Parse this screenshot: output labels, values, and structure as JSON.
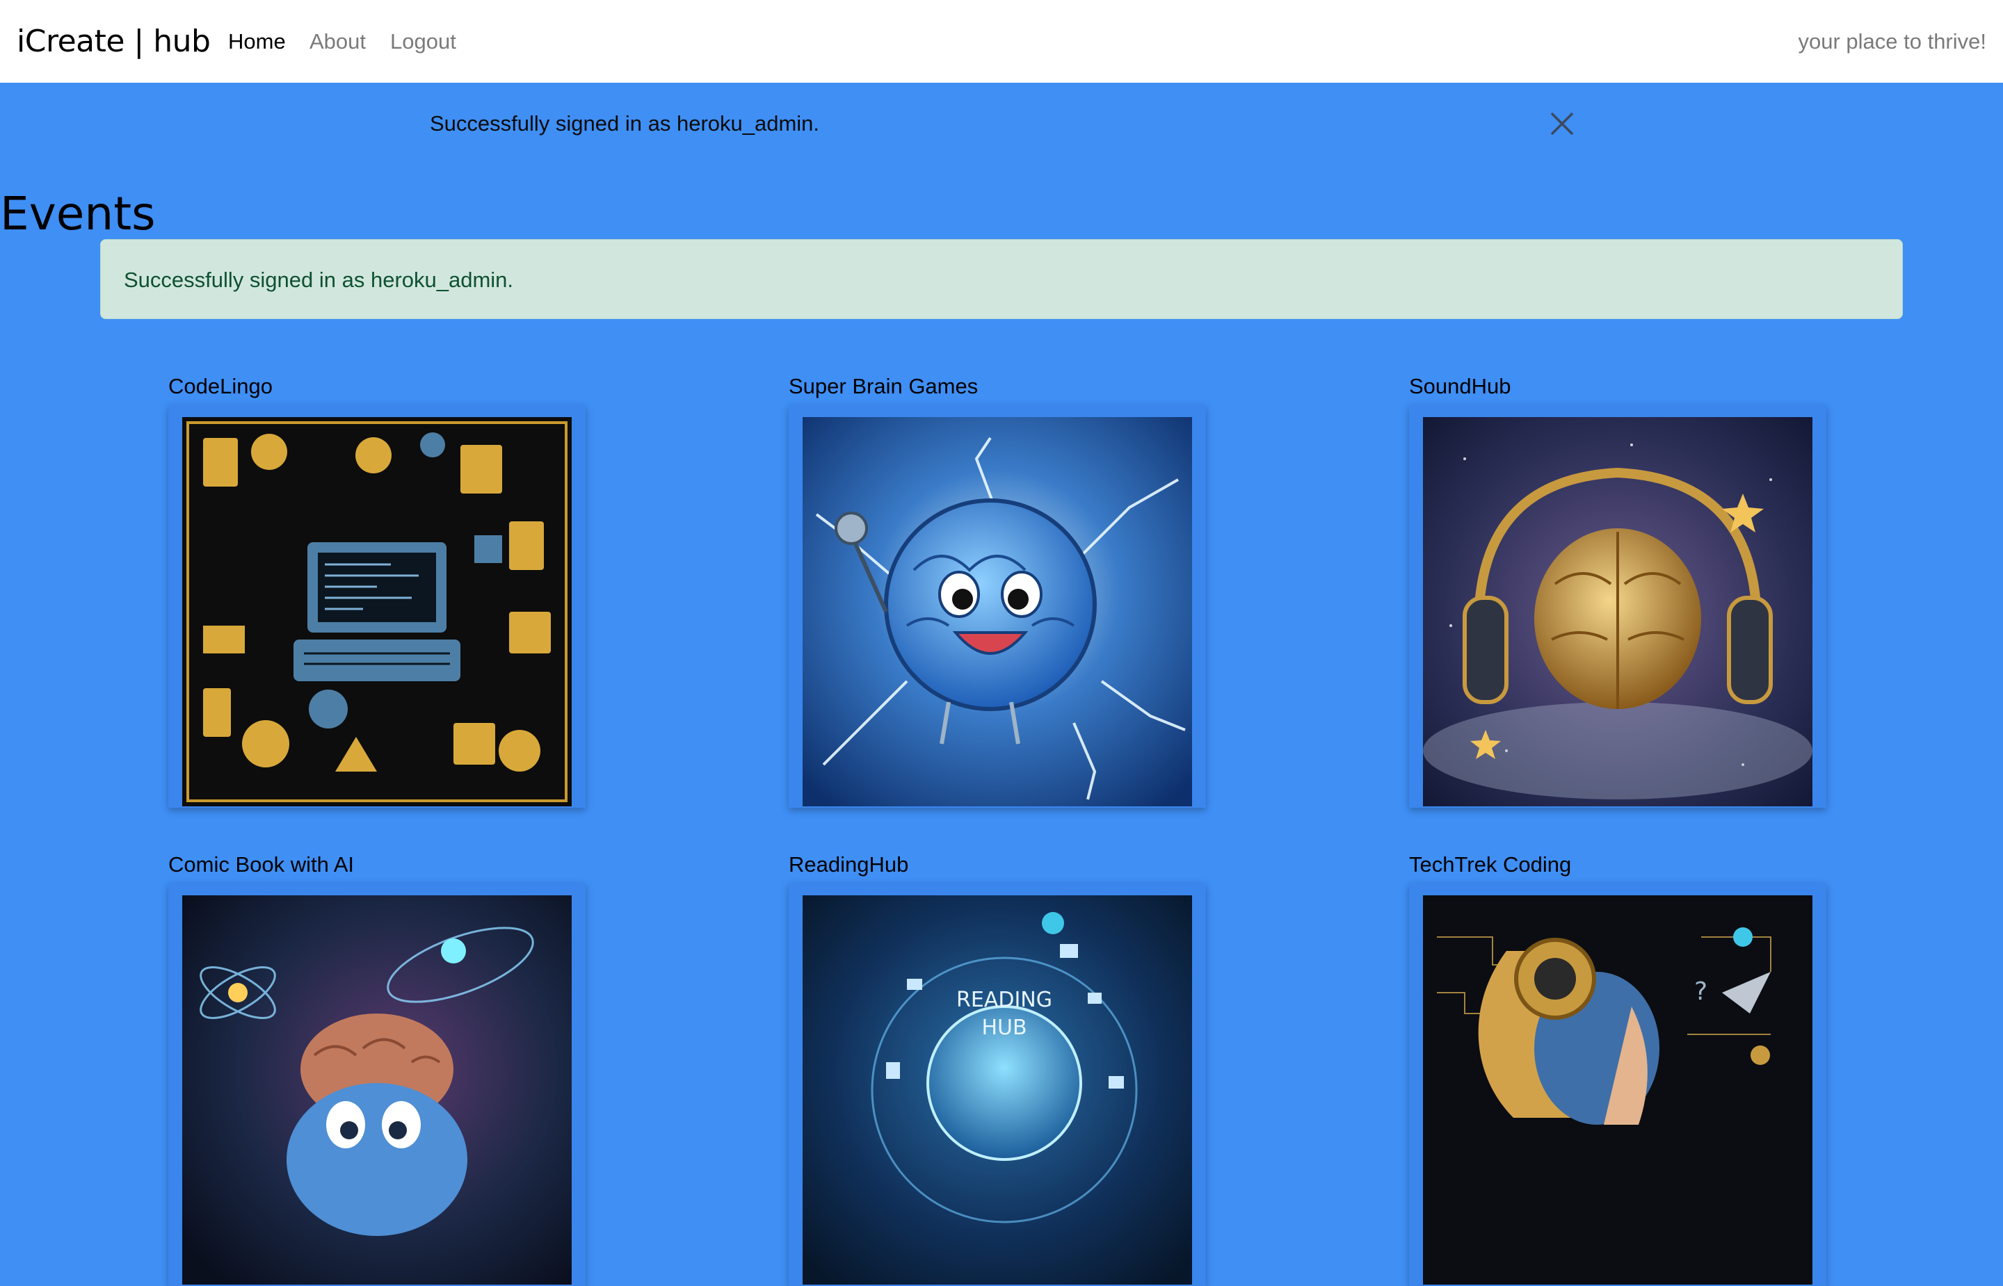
{
  "navbar": {
    "brand": "iCreate | hub",
    "links": [
      {
        "label": "Home",
        "active": true
      },
      {
        "label": "About",
        "active": false
      },
      {
        "label": "Logout",
        "active": false
      }
    ],
    "tagline": "your place to thrive!"
  },
  "flash": {
    "message": "Successfully signed in as heroku_admin.",
    "close_icon": "close-icon"
  },
  "page": {
    "title": "Events"
  },
  "alert": {
    "message": "Successfully signed in as heroku_admin."
  },
  "events": [
    {
      "title": "CodeLingo",
      "image_icon": "codelingo-illustration"
    },
    {
      "title": "Super Brain Games",
      "image_icon": "brain-lightning-illustration"
    },
    {
      "title": "SoundHub",
      "image_icon": "brain-headphones-illustration"
    },
    {
      "title": "Comic Book with AI",
      "image_icon": "comic-brain-illustration"
    },
    {
      "title": "ReadingHub",
      "image_icon": "reading-hub-globe-illustration"
    },
    {
      "title": "TechTrek Coding",
      "image_icon": "techtrek-girl-illustration"
    }
  ],
  "image_text": {
    "reading_hub_line1": "READING",
    "reading_hub_line2": "HUB"
  },
  "colors": {
    "page_bg": "#3f8ff5",
    "alert_bg": "#d1e7dd",
    "alert_text": "#0f5132",
    "nav_muted": "#7a7a7a"
  }
}
